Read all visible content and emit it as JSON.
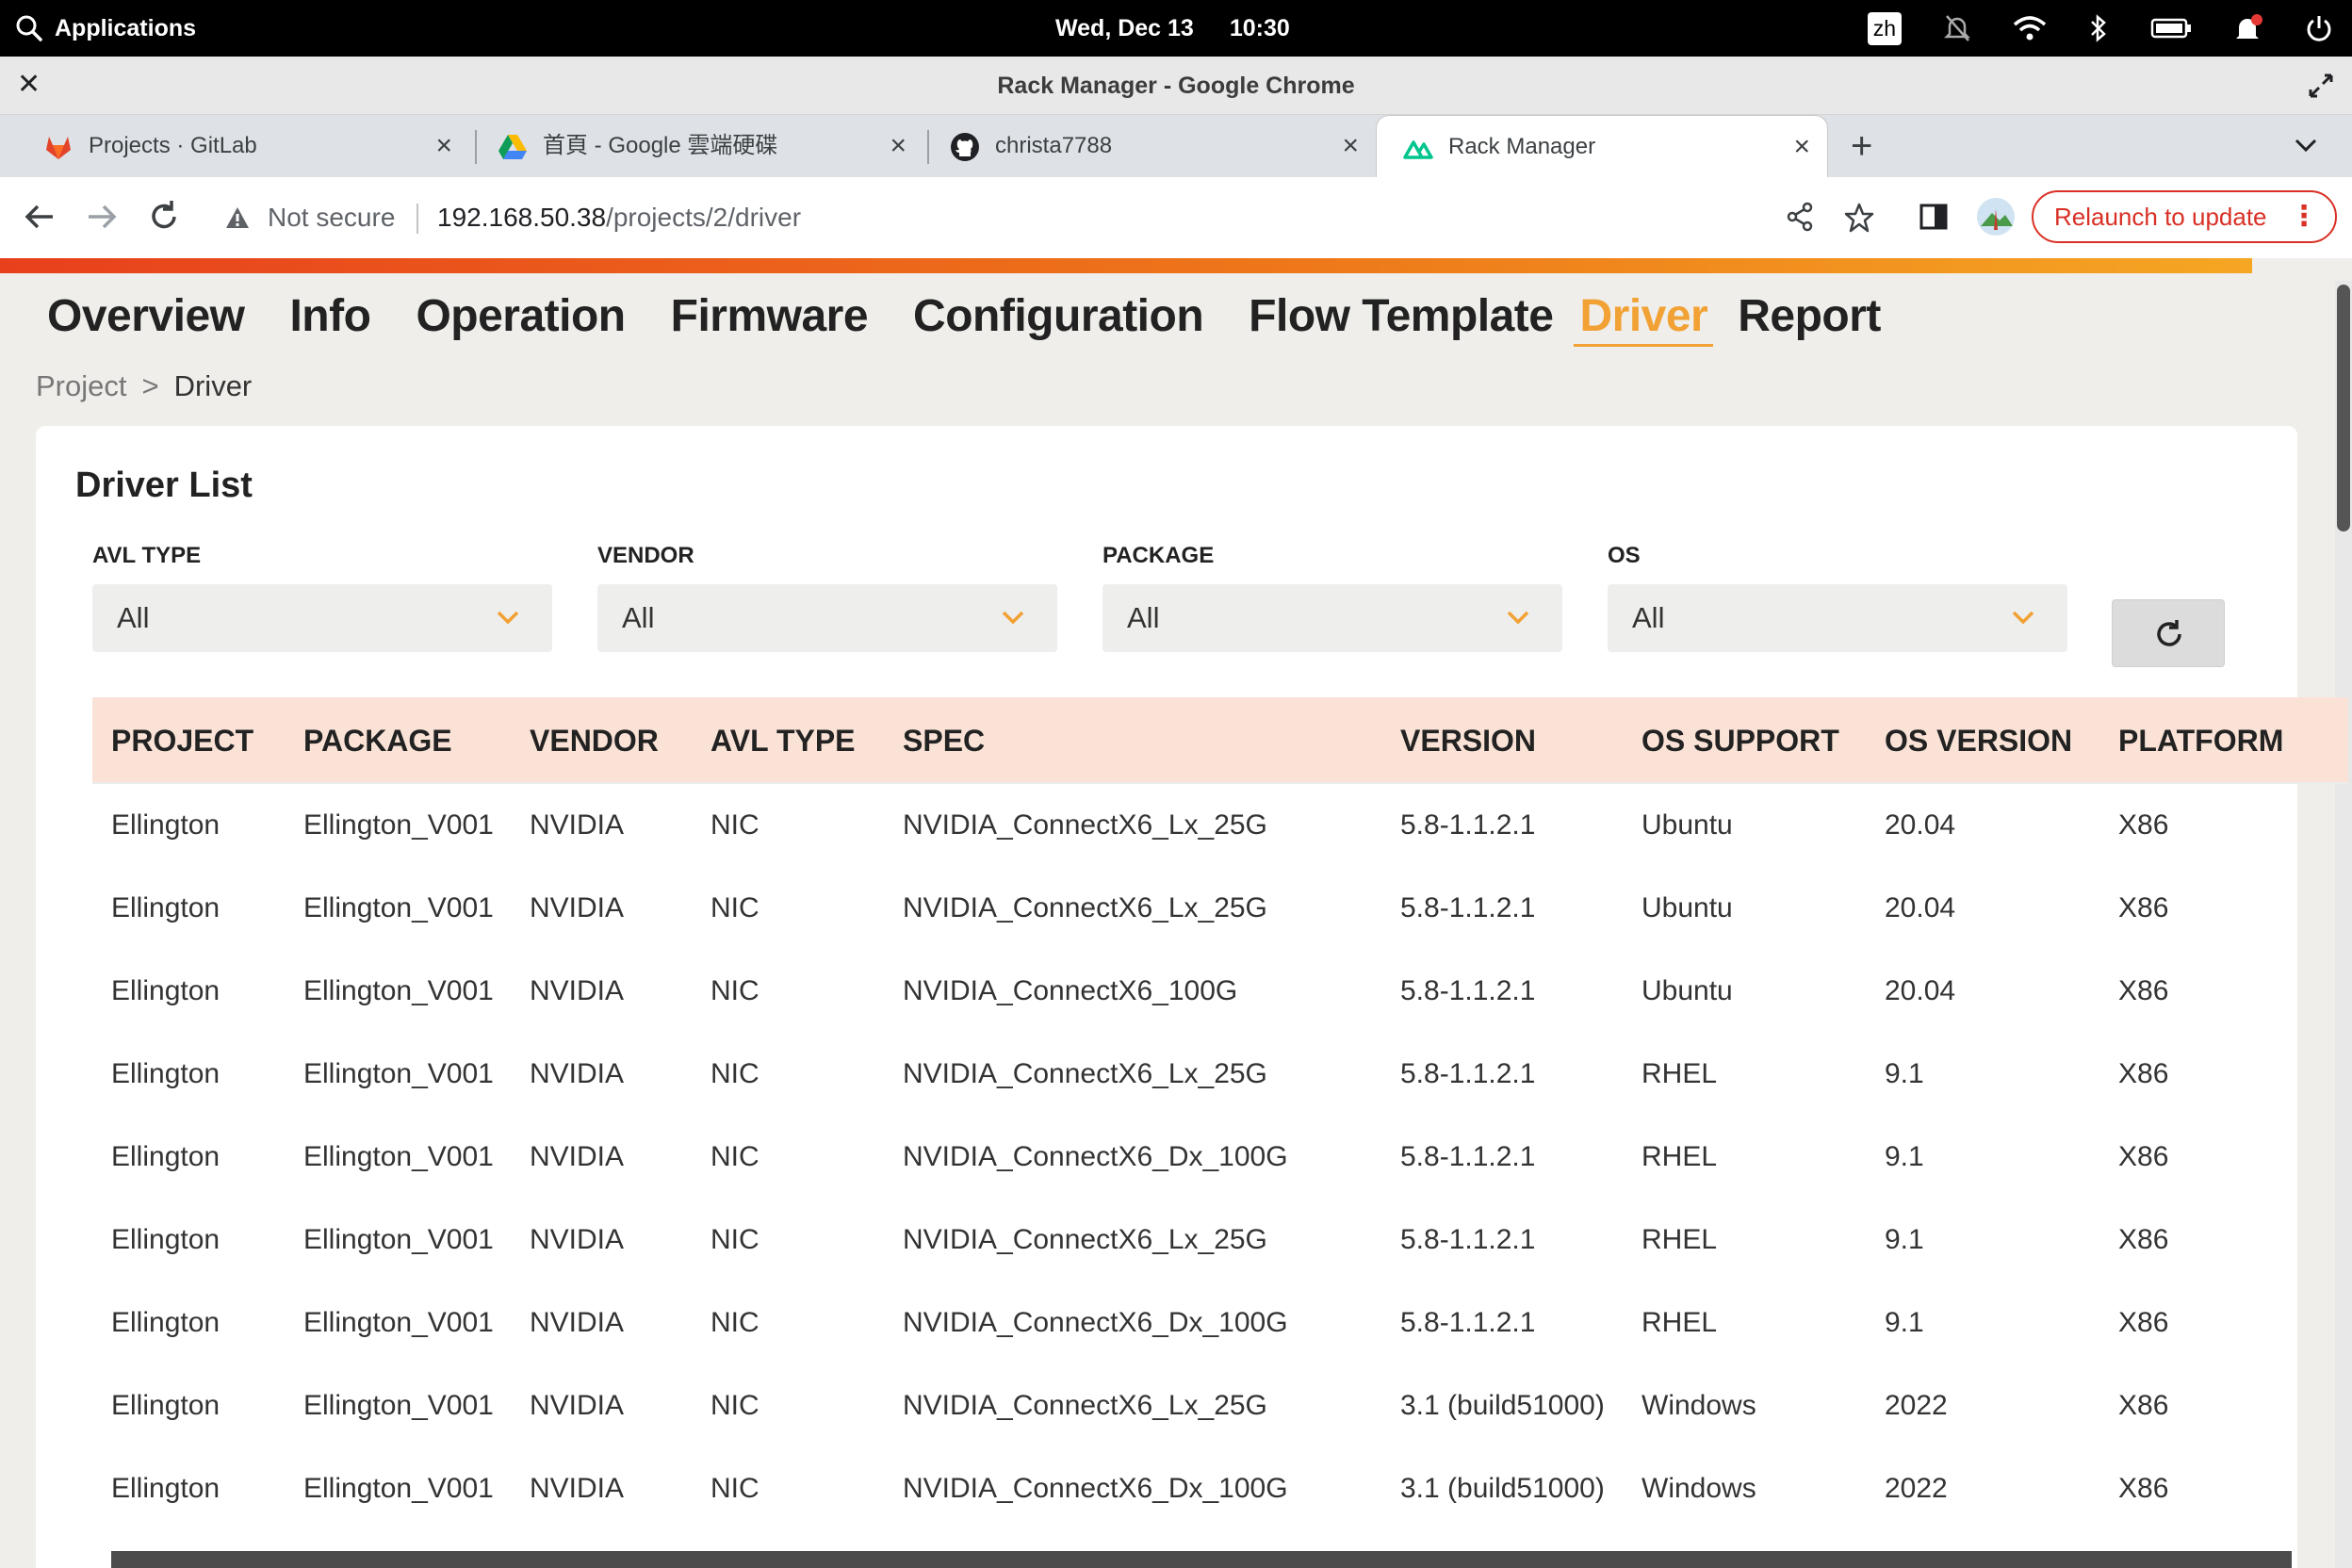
{
  "system": {
    "apps_label": "Applications",
    "date": "Wed, Dec 13",
    "time": "10:30",
    "lang": "zh"
  },
  "window": {
    "title": "Rack Manager - Google Chrome"
  },
  "tabs": [
    {
      "label": "Projects · GitLab",
      "icon": "gitlab-icon"
    },
    {
      "label": "首頁 - Google 雲端硬碟",
      "icon": "google-drive-icon"
    },
    {
      "label": "christa7788",
      "icon": "github-icon"
    },
    {
      "label": "Rack Manager",
      "icon": "nuxt-icon",
      "active": true
    }
  ],
  "toolbar": {
    "security": "Not secure",
    "url_host": "192.168.50.38",
    "url_path": "/projects/2/driver",
    "relaunch_label": "Relaunch to update"
  },
  "nav": {
    "items": [
      "Overview",
      "Info",
      "Operation",
      "Firmware",
      "Configuration",
      "Flow Template",
      "Driver",
      "Report"
    ],
    "active": "Driver"
  },
  "breadcrumb": {
    "parent": "Project",
    "separator": ">",
    "current": "Driver"
  },
  "card": {
    "title": "Driver List"
  },
  "filters": [
    {
      "label": "AVL TYPE",
      "value": "All"
    },
    {
      "label": "VENDOR",
      "value": "All"
    },
    {
      "label": "PACKAGE",
      "value": "All"
    },
    {
      "label": "OS",
      "value": "All"
    }
  ],
  "table": {
    "columns": [
      "PROJECT",
      "PACKAGE",
      "VENDOR",
      "AVL TYPE",
      "SPEC",
      "VERSION",
      "OS SUPPORT",
      "OS VERSION",
      "PLATFORM"
    ],
    "rows": [
      [
        "Ellington",
        "Ellington_V001",
        "NVIDIA",
        "NIC",
        "NVIDIA_ConnectX6_Lx_25G",
        "5.8-1.1.2.1",
        "Ubuntu",
        "20.04",
        "X86"
      ],
      [
        "Ellington",
        "Ellington_V001",
        "NVIDIA",
        "NIC",
        "NVIDIA_ConnectX6_Lx_25G",
        "5.8-1.1.2.1",
        "Ubuntu",
        "20.04",
        "X86"
      ],
      [
        "Ellington",
        "Ellington_V001",
        "NVIDIA",
        "NIC",
        "NVIDIA_ConnectX6_100G",
        "5.8-1.1.2.1",
        "Ubuntu",
        "20.04",
        "X86"
      ],
      [
        "Ellington",
        "Ellington_V001",
        "NVIDIA",
        "NIC",
        "NVIDIA_ConnectX6_Lx_25G",
        "5.8-1.1.2.1",
        "RHEL",
        "9.1",
        "X86"
      ],
      [
        "Ellington",
        "Ellington_V001",
        "NVIDIA",
        "NIC",
        "NVIDIA_ConnectX6_Dx_100G",
        "5.8-1.1.2.1",
        "RHEL",
        "9.1",
        "X86"
      ],
      [
        "Ellington",
        "Ellington_V001",
        "NVIDIA",
        "NIC",
        "NVIDIA_ConnectX6_Lx_25G",
        "5.8-1.1.2.1",
        "RHEL",
        "9.1",
        "X86"
      ],
      [
        "Ellington",
        "Ellington_V001",
        "NVIDIA",
        "NIC",
        "NVIDIA_ConnectX6_Dx_100G",
        "5.8-1.1.2.1",
        "RHEL",
        "9.1",
        "X86"
      ],
      [
        "Ellington",
        "Ellington_V001",
        "NVIDIA",
        "NIC",
        "NVIDIA_ConnectX6_Lx_25G",
        "3.1 (build51000)",
        "Windows",
        "2022",
        "X86"
      ],
      [
        "Ellington",
        "Ellington_V001",
        "NVIDIA",
        "NIC",
        "NVIDIA_ConnectX6_Dx_100G",
        "3.1 (build51000)",
        "Windows",
        "2022",
        "X86"
      ]
    ]
  },
  "colors": {
    "accent": "#f2a134",
    "header_bg": "#fae3d6",
    "relaunch": "#d93025"
  }
}
